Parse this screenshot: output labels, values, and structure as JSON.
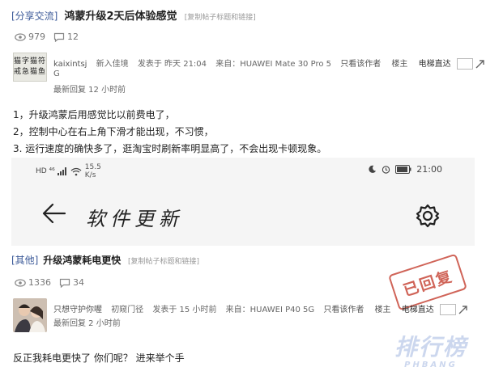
{
  "post1": {
    "category": "[分享交流]",
    "title": "鸿蒙升级2天后体验感觉",
    "copy_link": "[复制帖子标题和链接]",
    "views": "979",
    "comments": "12",
    "avatar_text": [
      "猫字猫符",
      "戒急猫鱼"
    ],
    "author": {
      "name": "kaixintsj",
      "name_cont": "G",
      "badge": "新入佳境",
      "posted": "发表于 昨天 21:04",
      "source": "来自：HUAWEI Mate 30 Pro 5",
      "only_author": "只看该作者",
      "role": "楼主",
      "elevator": "电梯直达",
      "latest_reply": "最新回复 12 小时前"
    },
    "body": [
      "1，升级鸿蒙后用感觉比以前费电了，",
      "2，控制中心在右上角下滑才能出现，不习惯，",
      "3. 运行速度的确快多了，逛淘宝时刷新率明显高了，不会出现卡顿现象。"
    ],
    "screenshot": {
      "status_left": "HD ⁴⁶",
      "speed_value": "15.5",
      "speed_unit": "K/s",
      "time": "21:00",
      "title": "软件更新"
    }
  },
  "post2": {
    "category": "[其他]",
    "title": "升级鸿蒙耗电更快",
    "copy_link": "[复制帖子标题和链接]",
    "views": "1336",
    "comments": "34",
    "author": {
      "name": "只想守护你喔",
      "badge": "初窥门径",
      "posted": "发表于 15 小时前",
      "source": "来自：HUAWEI P40 5G",
      "only_author": "只看该作者",
      "role": "楼主",
      "elevator": "电梯直达",
      "latest_reply": "最新回复 2 小时前"
    },
    "body": "反正我耗电更快了   你们呢？  进来举个手",
    "stamp": "已回复"
  },
  "watermark": {
    "big": "排行榜",
    "small": "PHBANG"
  },
  "colors": {
    "category_link": "#3b5998",
    "stamp": "#c84a3c"
  }
}
